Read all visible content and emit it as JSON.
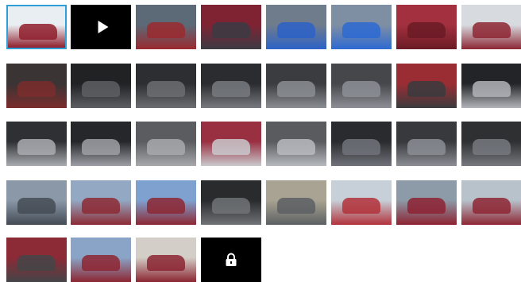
{
  "gallery": {
    "thumbnails": [
      {
        "kind": "photo",
        "name": "car-exterior-snow",
        "selected": true,
        "colors": [
          "#e9eef2",
          "#8f1f2d"
        ]
      },
      {
        "kind": "video",
        "name": "video",
        "icon": "play-icon",
        "colors": [
          "#000000",
          "#000000"
        ]
      },
      {
        "kind": "photo",
        "name": "car-rear-parking",
        "colors": [
          "#5c6a78",
          "#9a2a2f"
        ]
      },
      {
        "kind": "photo",
        "name": "car-front",
        "colors": [
          "#7f2333",
          "#3b3b44"
        ]
      },
      {
        "kind": "photo",
        "name": "car-lot",
        "colors": [
          "#6f7c8b",
          "#2d62c8"
        ]
      },
      {
        "kind": "photo",
        "name": "blue-car-lot",
        "colors": [
          "#7f8fa3",
          "#2d6ad2"
        ]
      },
      {
        "kind": "photo",
        "name": "car-front-closeup",
        "colors": [
          "#a3303e",
          "#6a1b26"
        ]
      },
      {
        "kind": "photo",
        "name": "car-front-angle",
        "colors": [
          "#d7dbe0",
          "#8d2734"
        ]
      },
      {
        "kind": "photo",
        "name": "interior-driver-seat",
        "colors": [
          "#3a3434",
          "#7b2d2d"
        ]
      },
      {
        "kind": "photo",
        "name": "interior-steering",
        "colors": [
          "#202224",
          "#5d5f62"
        ]
      },
      {
        "kind": "photo",
        "name": "interior-dashboard",
        "colors": [
          "#2d2e31",
          "#6b6d70"
        ]
      },
      {
        "kind": "photo",
        "name": "interior-console",
        "colors": [
          "#2b2c2f",
          "#777a7f"
        ]
      },
      {
        "kind": "photo",
        "name": "interior-rear-seats",
        "colors": [
          "#3b3c3f",
          "#8a8d92"
        ]
      },
      {
        "kind": "photo",
        "name": "interior-rear-seats-2",
        "colors": [
          "#46474b",
          "#8c8f95"
        ]
      },
      {
        "kind": "photo",
        "name": "interior-door-open",
        "colors": [
          "#9a2d33",
          "#3a3b3e"
        ]
      },
      {
        "kind": "photo",
        "name": "interior-door-panel",
        "colors": [
          "#232427",
          "#b0b3b8"
        ]
      },
      {
        "kind": "photo",
        "name": "door-panel",
        "colors": [
          "#2f3034",
          "#a9acb1"
        ]
      },
      {
        "kind": "photo",
        "name": "door-trim",
        "colors": [
          "#26272a",
          "#9da0a6"
        ]
      },
      {
        "kind": "photo",
        "name": "seat-detail",
        "colors": [
          "#5b5c60",
          "#a7a9ad"
        ]
      },
      {
        "kind": "photo",
        "name": "door-handle",
        "colors": [
          "#993042",
          "#c9c9cd"
        ]
      },
      {
        "kind": "photo",
        "name": "trunk-empty",
        "colors": [
          "#5a5b5f",
          "#b7babf"
        ]
      },
      {
        "kind": "photo",
        "name": "rear-floor",
        "colors": [
          "#2a2b2e",
          "#70737a"
        ]
      },
      {
        "kind": "photo",
        "name": "seat-rear-angle",
        "colors": [
          "#38393d",
          "#8b8e94"
        ]
      },
      {
        "kind": "photo",
        "name": "floor-mat",
        "colors": [
          "#2f3032",
          "#76797f"
        ]
      },
      {
        "kind": "photo",
        "name": "parking-lot-cars",
        "colors": [
          "#8a98a7",
          "#444b54"
        ]
      },
      {
        "kind": "photo",
        "name": "car-side-parking",
        "colors": [
          "#93a8c3",
          "#8c2a34"
        ]
      },
      {
        "kind": "photo",
        "name": "car-side-parking-2",
        "colors": [
          "#7ea1d0",
          "#8c2732"
        ]
      },
      {
        "kind": "photo",
        "name": "trunk-spare-wheel",
        "colors": [
          "#2a2b2d",
          "#707377"
        ]
      },
      {
        "kind": "photo",
        "name": "building-parking",
        "colors": [
          "#a8a392",
          "#5c5f63"
        ]
      },
      {
        "kind": "photo",
        "name": "car-red-front",
        "colors": [
          "#c7d0d8",
          "#b2313a"
        ]
      },
      {
        "kind": "photo",
        "name": "car-front-yard",
        "colors": [
          "#8d9aa7",
          "#8c2232"
        ]
      },
      {
        "kind": "photo",
        "name": "car-front-yard-2",
        "colors": [
          "#b7c2cb",
          "#8e2634"
        ]
      },
      {
        "kind": "photo",
        "name": "car-front-low",
        "colors": [
          "#8c2a35",
          "#444548"
        ]
      },
      {
        "kind": "photo",
        "name": "car-side-field",
        "colors": [
          "#8aa4c7",
          "#8d2632"
        ]
      },
      {
        "kind": "photo",
        "name": "car-building",
        "colors": [
          "#d3cec7",
          "#8b2632"
        ]
      },
      {
        "kind": "locked",
        "name": "locked",
        "icon": "lock-icon",
        "colors": [
          "#000000",
          "#000000"
        ]
      }
    ]
  }
}
